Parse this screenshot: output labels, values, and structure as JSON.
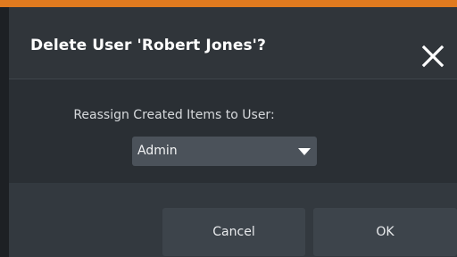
{
  "dialog": {
    "title": "Delete User 'Robert Jones'?",
    "close_icon": "close-icon",
    "reassign_label": "Reassign Created Items to User:",
    "reassign_select": {
      "value": "Admin",
      "caret_icon": "caret-down-icon"
    },
    "buttons": {
      "cancel": "Cancel",
      "ok": "OK"
    }
  },
  "colors": {
    "accent": "#e07a1f",
    "header_bg": "#30353a",
    "body_bg": "#2a2f34",
    "footer_bg": "#33393f",
    "button_bg": "#3d444b",
    "select_bg": "#4b525a",
    "text": "#ffffff"
  }
}
